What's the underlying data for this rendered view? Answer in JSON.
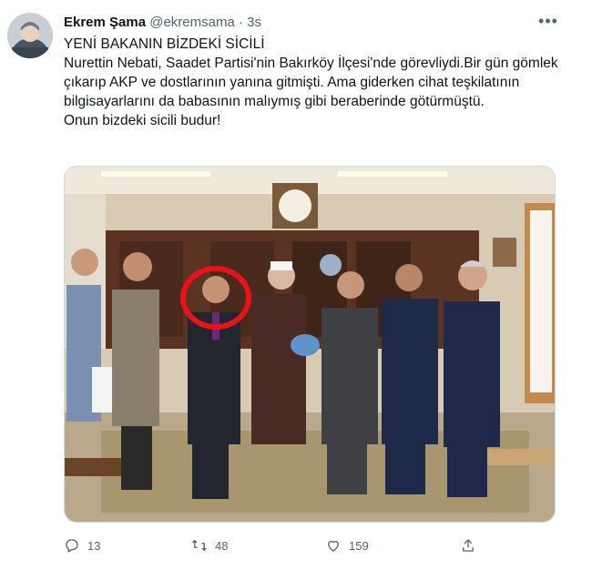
{
  "tweet": {
    "author_name": "Ekrem Şama",
    "author_handle": "@ekremsama",
    "separator": "·",
    "time": "3s",
    "lines": [
      "YENİ BAKANIN BİZDEKİ SİCİLİ",
      "Nurettin Nebati, Saadet Partisi'nin Bakırköy İlçesi'nde görevliydi.Bir gün gömlek çıkarıp AKP ve dostlarının yanına gitmişti. Ama giderken cihat teşkilatının bilgisayarlarını da babasının malıymış gibi beraberinde götürmüştü.",
      "Onun bizdeki sicili budur!"
    ]
  },
  "icons": {
    "more": "more-horizontal-icon",
    "reply": "reply-icon",
    "retweet": "retweet-icon",
    "like": "heart-icon",
    "share": "share-icon"
  },
  "actions": {
    "reply_count": "13",
    "retweet_count": "48",
    "like_count": "159"
  },
  "colors": {
    "text": "#0f1419",
    "secondary": "#536471",
    "highlight_circle": "#e8131a"
  }
}
